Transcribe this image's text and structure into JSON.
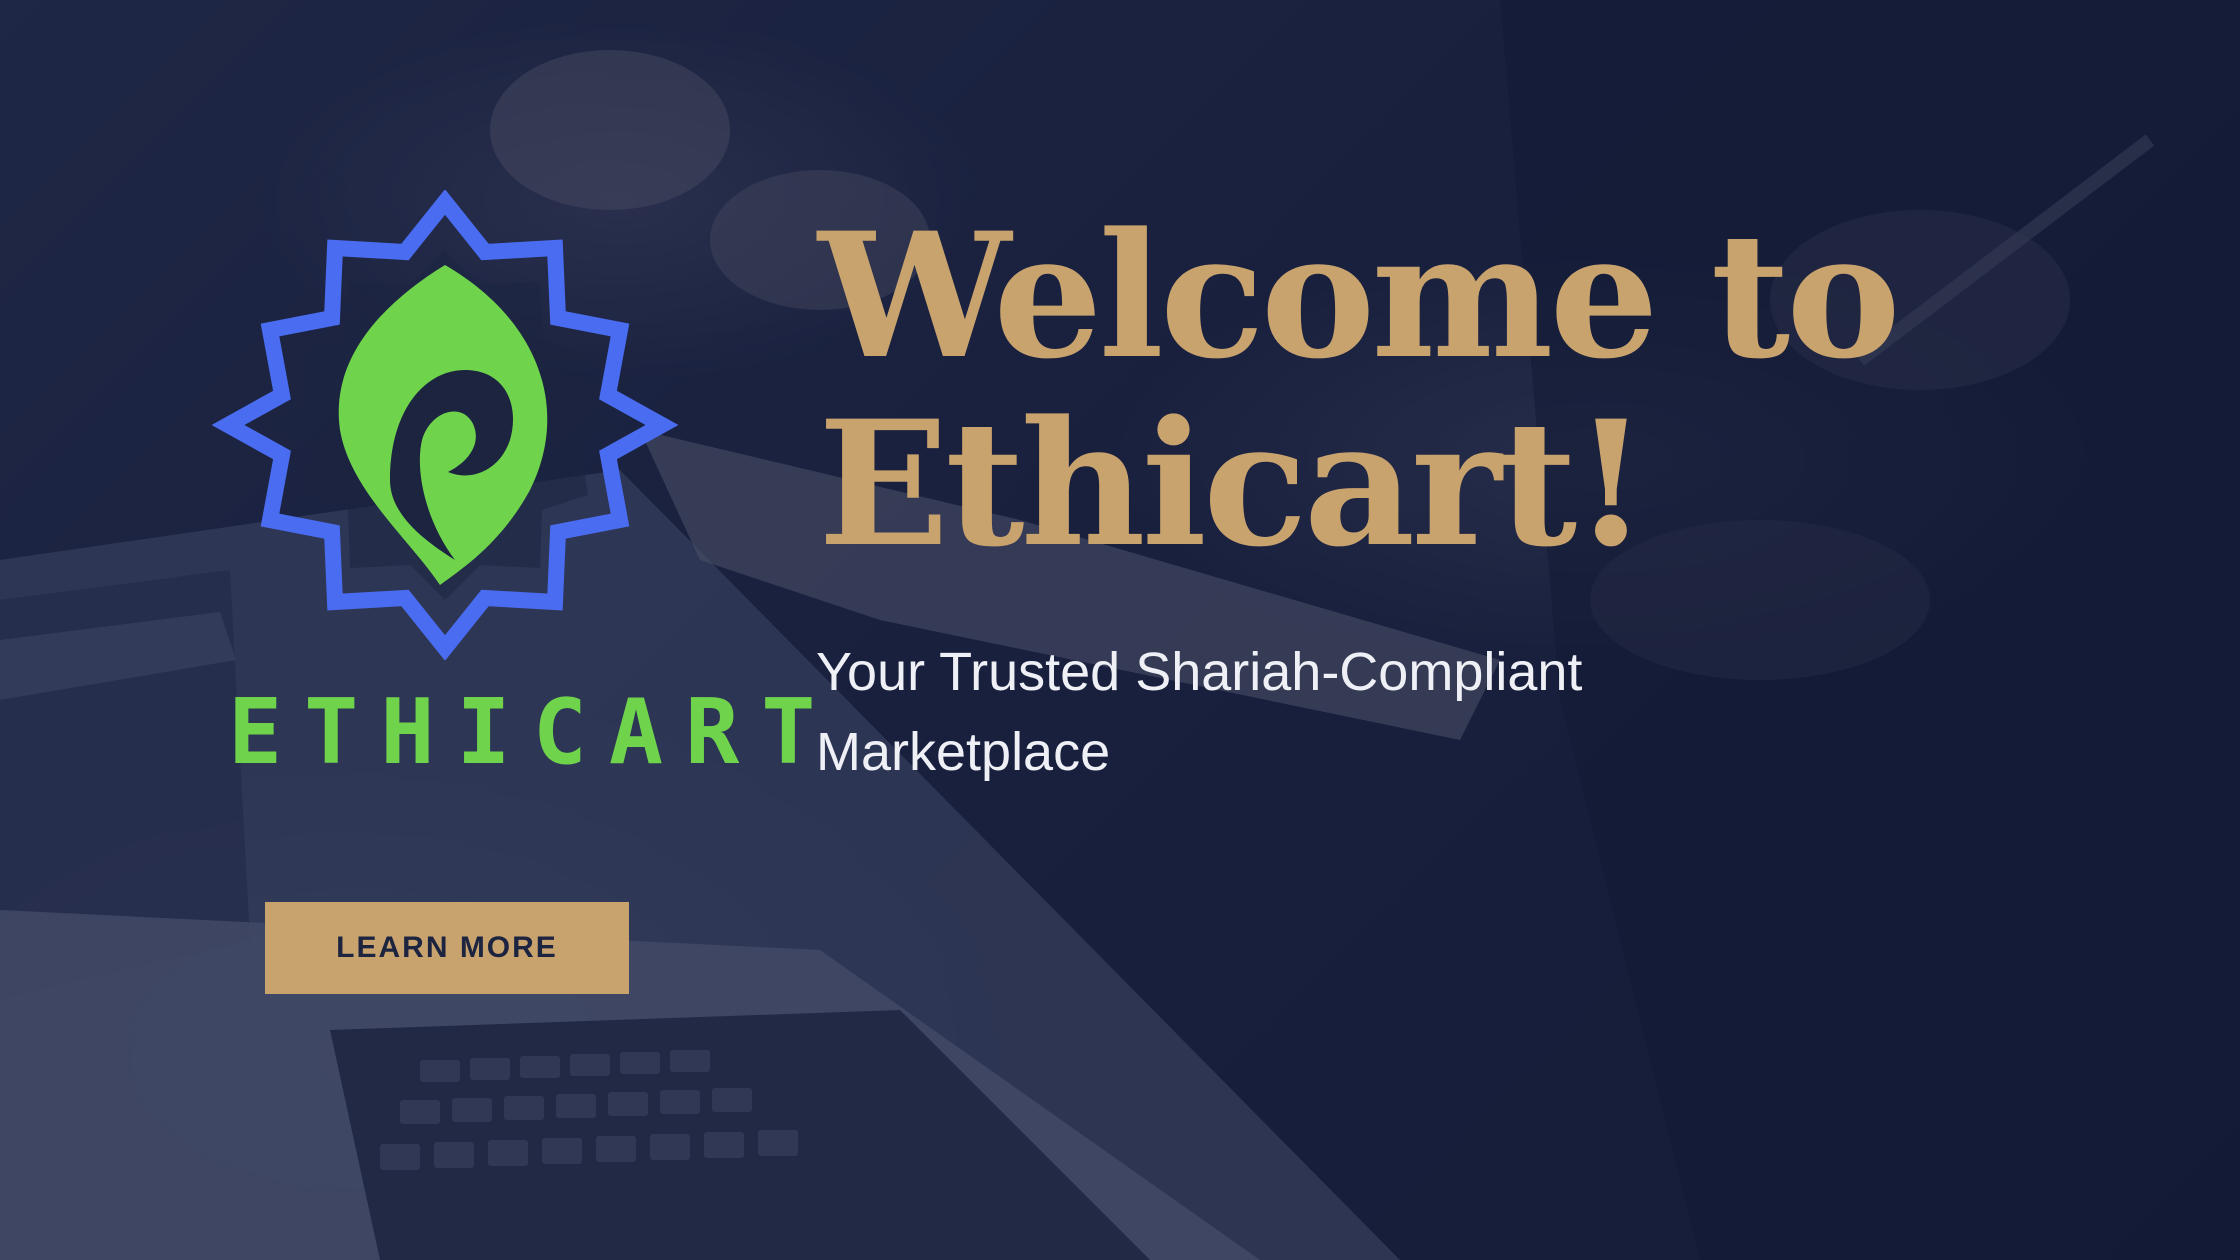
{
  "brand": {
    "wordmark": "ETHICART",
    "icon": "ethicart-leaf-star-logo"
  },
  "hero": {
    "headline_line1": "Welcome to",
    "headline_line2": "Ethicart!",
    "subtitle_line1": "Your Trusted Shariah-Compliant",
    "subtitle_line2": "Marketplace",
    "cta_label": "LEARN MORE"
  },
  "colors": {
    "gold": "#c9a36e",
    "green": "#6fd44c",
    "blue": "#4a6cf0",
    "navy": "#1c2440"
  }
}
